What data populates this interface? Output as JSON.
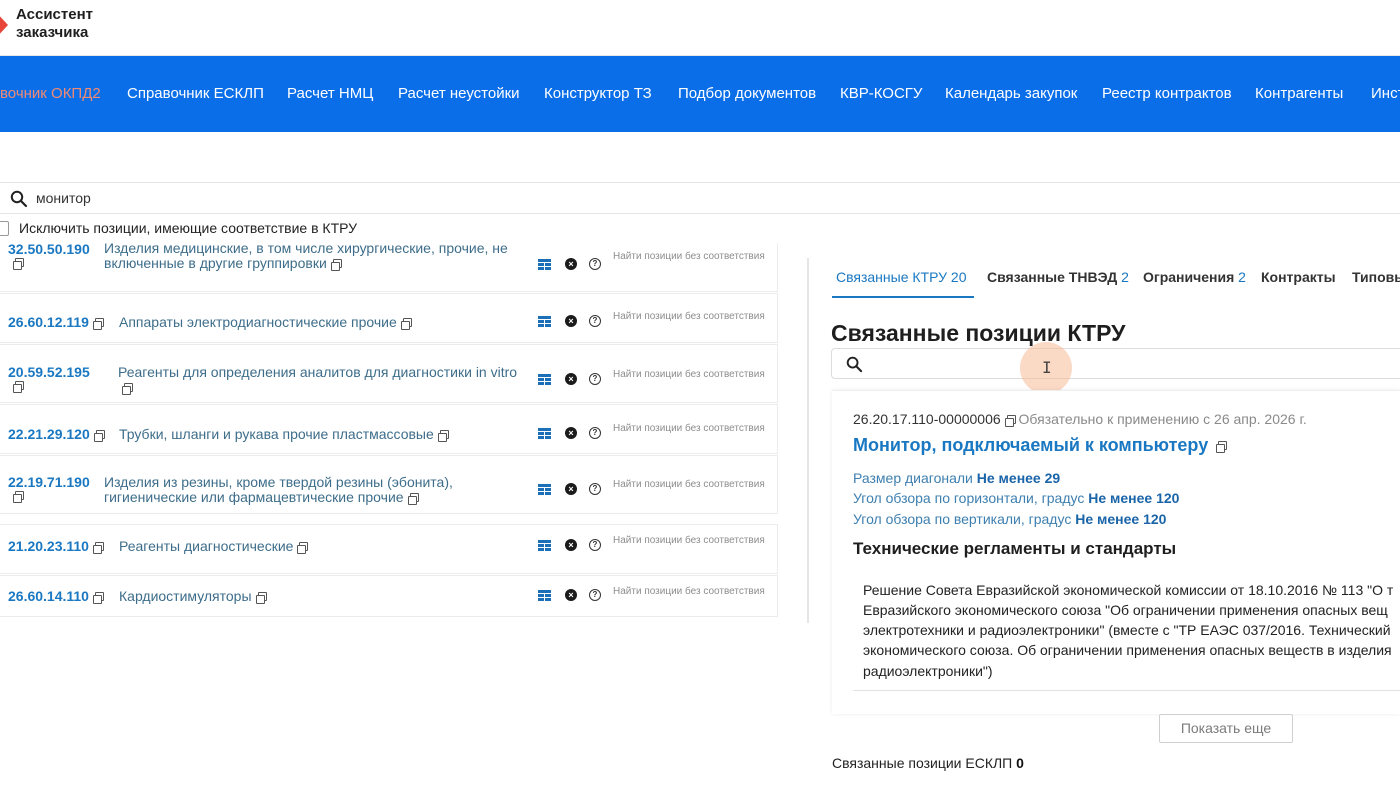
{
  "header": {
    "logo_line1": "Ассистент",
    "logo_line2": "заказчика",
    "brand_color": "#e8463a"
  },
  "nav": {
    "items": [
      {
        "label": "вочник ОКПД2",
        "active": true
      },
      {
        "label": "Справочник ЕСКЛП"
      },
      {
        "label": "Расчет НМЦ"
      },
      {
        "label": "Расчет неустойки"
      },
      {
        "label": "Конструктор ТЗ"
      },
      {
        "label": "Подбор документов"
      },
      {
        "label": "КВР-КОСГУ"
      },
      {
        "label": "Календарь закупок"
      },
      {
        "label": "Реестр контрактов"
      },
      {
        "label": "Контрагенты"
      },
      {
        "label": "Инст"
      }
    ],
    "bg_color": "#0a6ee8"
  },
  "search": {
    "value": "монитор"
  },
  "filter": {
    "exclude_label": "Исключить позиции, имеющие соответствие в КТРУ"
  },
  "list": {
    "find_label": "Найти позиции без соответствия",
    "rows": [
      {
        "code": "32.50.50.190",
        "name_line1": "Изделия медицинские, в том числе хирургические, прочие, не",
        "name_line2": "включенные в другие группировки"
      },
      {
        "code": "26.60.12.119",
        "name_line1": "Аппараты электродиагностические прочие"
      },
      {
        "code": "20.59.52.195",
        "name_line1": "Реагенты для определения аналитов для диагностики in vitro"
      },
      {
        "code": "22.21.29.120",
        "name_line1": "Трубки, шланги и рукава прочие пластмассовые"
      },
      {
        "code": "22.19.71.190",
        "name_line1": "Изделия из резины, кроме твердой резины (эбонита),",
        "name_line2": "гигиенические или фармацевтические прочие"
      },
      {
        "code": "21.20.23.110",
        "name_line1": "Реагенты диагностические"
      },
      {
        "code": "26.60.14.110",
        "name_line1": "Кардиостимуляторы"
      }
    ]
  },
  "tabs": [
    {
      "label": "Связанные КТРУ",
      "count": "20",
      "active": true
    },
    {
      "label": "Связанные ТНВЭД",
      "count": "2"
    },
    {
      "label": "Ограничения",
      "count": "2"
    },
    {
      "label": "Контракты",
      "count": ""
    },
    {
      "label": "Типовы",
      "count": ""
    }
  ],
  "panel": {
    "title": "Связанные позиции КТРУ",
    "card": {
      "code": "26.20.17.110-00000006",
      "hint": "Обязательно к применению с 26 апр. 2026 г.",
      "title": "Монитор, подключаемый к компьютеру",
      "attrs": [
        {
          "name": "Размер диагонали",
          "value": "Не менее 29"
        },
        {
          "name": "Угол обзора по горизонтали, градус",
          "value": "Не менее 120"
        },
        {
          "name": "Угол обзора по вертикали, градус",
          "value": "Не менее 120"
        }
      ],
      "reg_title": "Технические регламенты и стандарты",
      "reg_lines": [
        "Решение Совета Евразийской экономической комиссии от 18.10.2016 № 113 \"О т",
        "Евразийского экономического союза \"Об ограничении применения опасных вещ",
        "электротехники и радиоэлектроники\" (вместе с \"ТР ЕАЭС 037/2016. Технический",
        "экономического союза. Об ограничении применения опасных веществ в изделия",
        "радиоэлектроники\")"
      ]
    },
    "show_more": "Показать еще",
    "esklp_label": "Связанные позиции ЕСКЛП",
    "esklp_count": "0",
    "accent_color": "#1a78c2"
  }
}
